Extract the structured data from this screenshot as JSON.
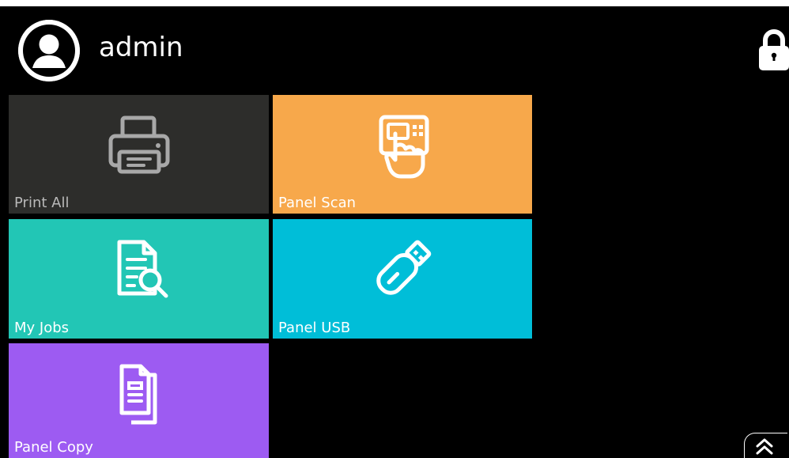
{
  "user": {
    "name": "admin"
  },
  "tiles": [
    {
      "label": "Print All",
      "icon": "printer-icon",
      "color": "#2d2d2b"
    },
    {
      "label": "Panel Scan",
      "icon": "scan-touch-icon",
      "color": "#f7a84b"
    },
    {
      "label": "My Jobs",
      "icon": "document-search-icon",
      "color": "#22c6b5"
    },
    {
      "label": "Panel USB",
      "icon": "usb-drive-icon",
      "color": "#00bed8"
    },
    {
      "label": "Panel Copy",
      "icon": "copy-documents-icon",
      "color": "#9d5bf2"
    }
  ],
  "controls": {
    "lock": "lock-icon",
    "scroll_up": "double-chevron-up-icon"
  }
}
